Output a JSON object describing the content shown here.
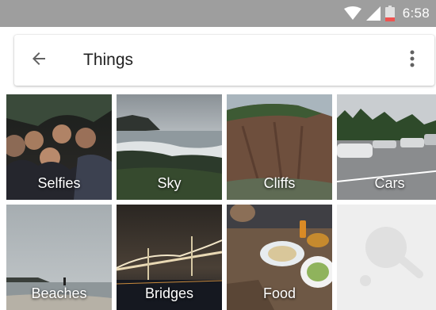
{
  "status_bar": {
    "time": "6:58",
    "icons": [
      "wifi-icon",
      "signal-icon",
      "battery-low-icon"
    ]
  },
  "search_bar": {
    "query": "Things",
    "back_icon": "arrow-back-icon",
    "more_icon": "more-vert-icon"
  },
  "tiles": [
    {
      "label": "Selfies"
    },
    {
      "label": "Sky"
    },
    {
      "label": "Cliffs"
    },
    {
      "label": "Cars"
    },
    {
      "label": "Beaches"
    },
    {
      "label": "Bridges"
    },
    {
      "label": "Food"
    },
    {
      "label": ""
    }
  ],
  "colors": {
    "status_bar": "#9e9e9e",
    "placeholder_tile": "#eeeeee",
    "battery_warning": "#ef5350"
  }
}
